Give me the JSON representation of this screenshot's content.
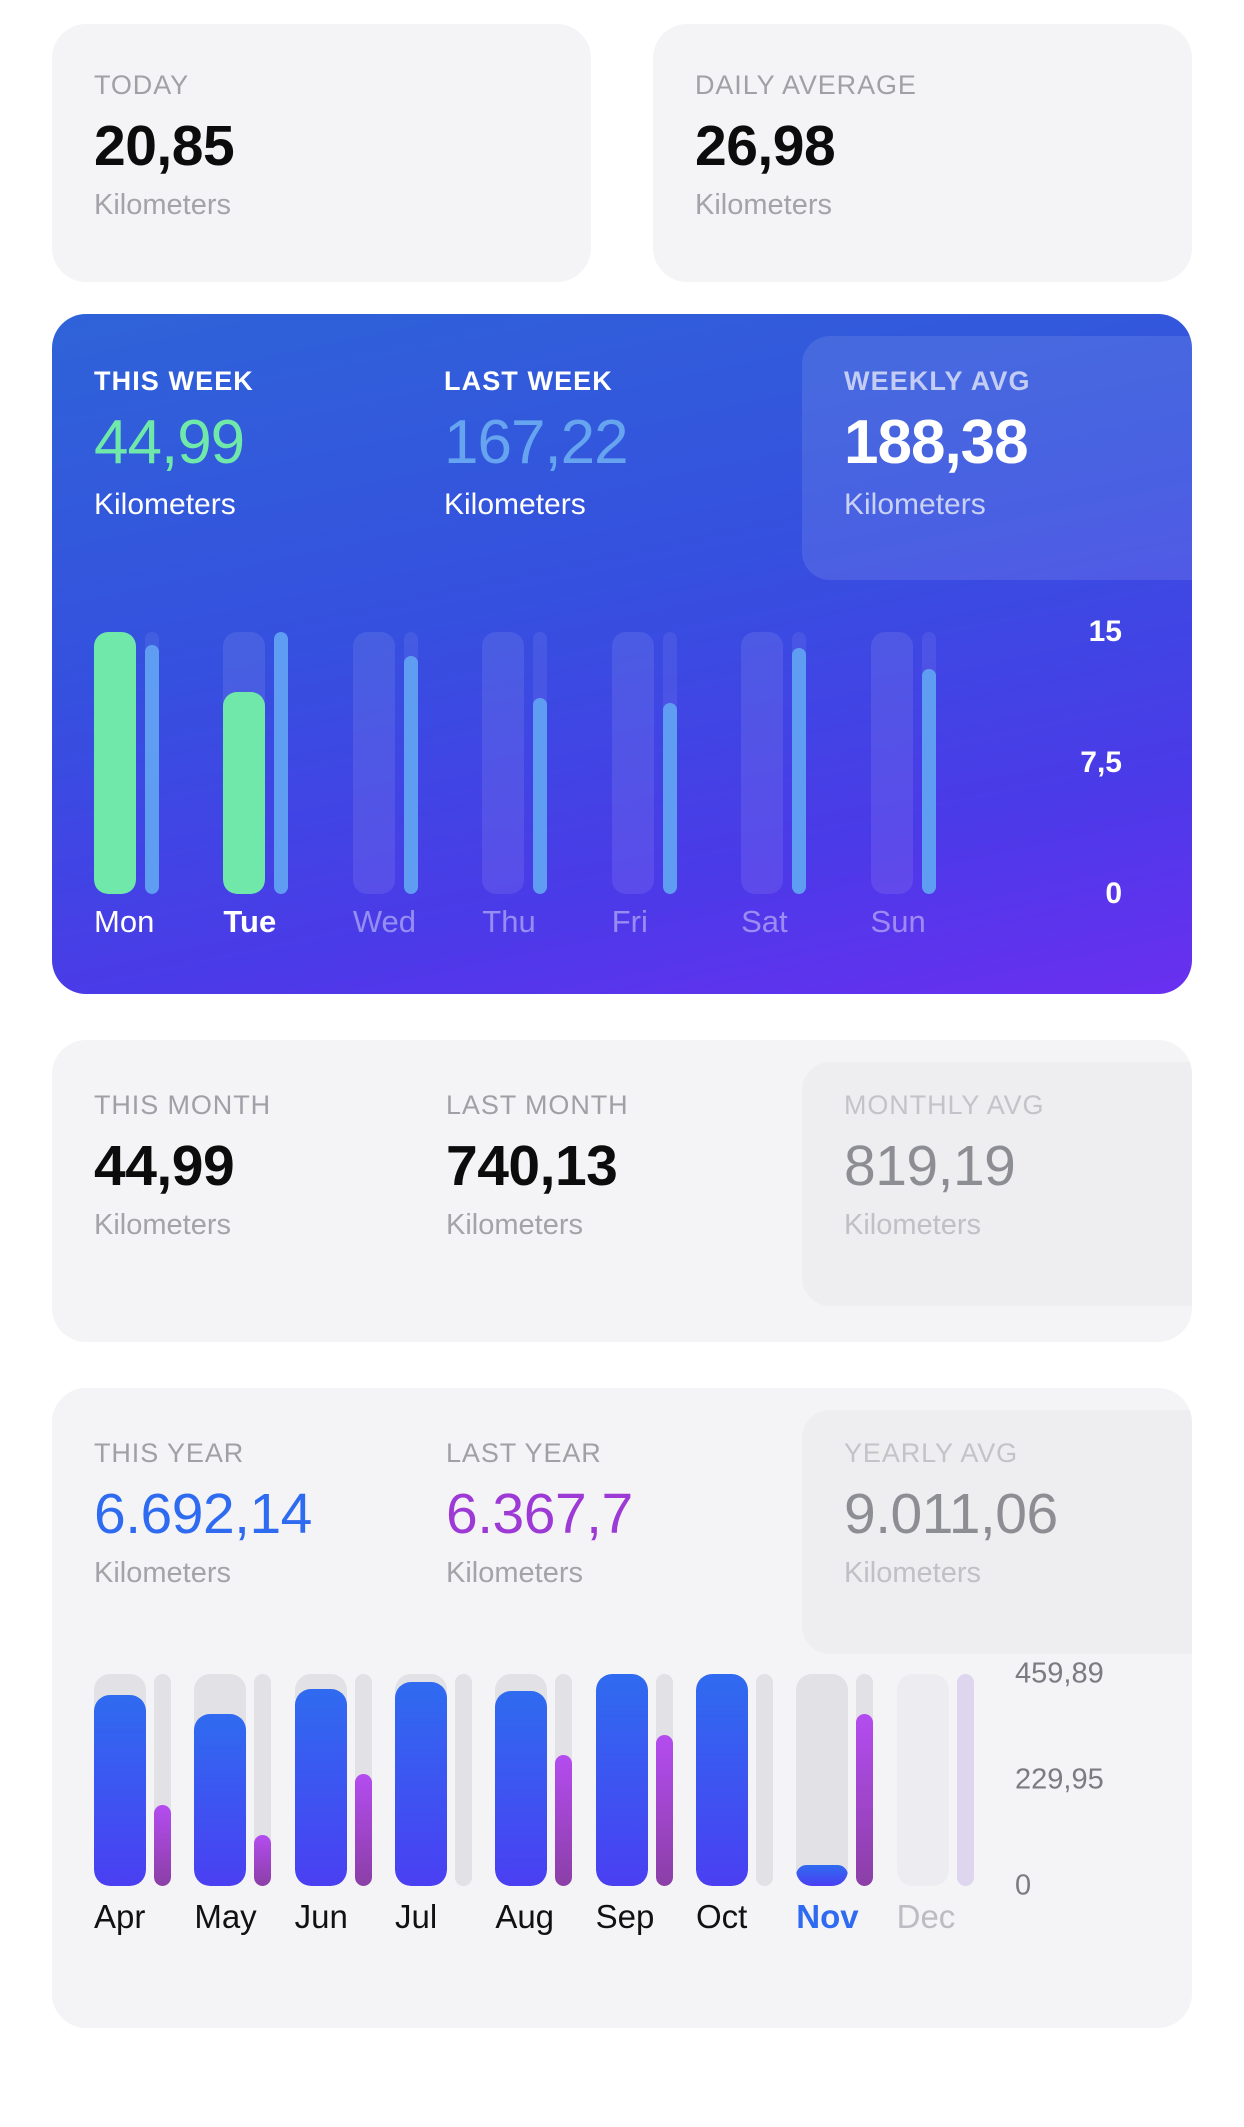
{
  "unit": "Kilometers",
  "colors": {
    "green": "#6fe8a9",
    "light_blue": "#67a4ef",
    "blue": "#2f6bf0",
    "purple": "#9d3ad6",
    "card_bg": "#f4f4f6"
  },
  "today": {
    "label": "TODAY",
    "value": "20,85",
    "unit": "Kilometers"
  },
  "daily_average": {
    "label": "DAILY AVERAGE",
    "value": "26,98",
    "unit": "Kilometers"
  },
  "week": {
    "this_week": {
      "label": "THIS WEEK",
      "value": "44,99",
      "unit": "Kilometers"
    },
    "last_week": {
      "label": "LAST WEEK",
      "value": "167,22",
      "unit": "Kilometers"
    },
    "weekly_avg": {
      "label": "WEEKLY AVG",
      "value": "188,38",
      "unit": "Kilometers"
    }
  },
  "month": {
    "this_month": {
      "label": "THIS MONTH",
      "value": "44,99",
      "unit": "Kilometers"
    },
    "last_month": {
      "label": "LAST MONTH",
      "value": "740,13",
      "unit": "Kilometers"
    },
    "monthly_avg": {
      "label": "MONTHLY AVG",
      "value": "819,19",
      "unit": "Kilometers"
    }
  },
  "year": {
    "this_year": {
      "label": "THIS YEAR",
      "value": "6.692,14",
      "unit": "Kilometers"
    },
    "last_year": {
      "label": "LAST YEAR",
      "value": "6.367,7",
      "unit": "Kilometers"
    },
    "yearly_avg": {
      "label": "YEARLY AVG",
      "value": "9.011,06",
      "unit": "Kilometers"
    }
  },
  "chart_data": [
    {
      "type": "bar",
      "title": "This week vs last week daily distance",
      "xlabel": "",
      "ylabel": "Kilometers",
      "categories": [
        "Mon",
        "Tue",
        "Wed",
        "Thu",
        "Fri",
        "Sat",
        "Sun"
      ],
      "ylim": [
        0,
        15
      ],
      "yticks": [
        "0",
        "7,5",
        "15"
      ],
      "grid": false,
      "legend": "none",
      "current_category": "Tue",
      "series": [
        {
          "name": "This week",
          "color": "#6fe8a9",
          "values": [
            15,
            11.5,
            0,
            0,
            0,
            0,
            0
          ]
        },
        {
          "name": "Last week",
          "color": "#5f9df3",
          "values": [
            14.2,
            15,
            13.6,
            11.2,
            10.9,
            14.1,
            12.8
          ]
        }
      ]
    },
    {
      "type": "bar",
      "title": "This year vs last year monthly distance",
      "xlabel": "",
      "ylabel": "Kilometers",
      "categories": [
        "Apr",
        "May",
        "Jun",
        "Jul",
        "Aug",
        "Sep",
        "Oct",
        "Nov",
        "Dec"
      ],
      "ylim": [
        0,
        459.89
      ],
      "yticks": [
        "0",
        "229,95",
        "459,89"
      ],
      "grid": false,
      "legend": "none",
      "current_category": "Nov",
      "series": [
        {
          "name": "This year",
          "color": "#2f6bf0",
          "values": [
            415,
            375,
            429,
            442,
            423,
            460,
            459,
            45,
            0
          ]
        },
        {
          "name": "Last year",
          "color": "#b44cf0",
          "values": [
            175,
            110,
            245,
            0,
            285,
            325,
            0,
            372,
            0
          ]
        }
      ]
    }
  ],
  "week_chart_render": {
    "bars": [
      {
        "day": "Mon",
        "state": "active",
        "primary_pct": 100,
        "secondary_pct": 95
      },
      {
        "day": "Tue",
        "state": "current",
        "primary_pct": 77,
        "secondary_pct": 100
      },
      {
        "day": "Wed",
        "state": "future",
        "primary_pct": 0,
        "secondary_pct": 91
      },
      {
        "day": "Thu",
        "state": "future",
        "primary_pct": 0,
        "secondary_pct": 75
      },
      {
        "day": "Fri",
        "state": "future",
        "primary_pct": 0,
        "secondary_pct": 73
      },
      {
        "day": "Sat",
        "state": "future",
        "primary_pct": 0,
        "secondary_pct": 94
      },
      {
        "day": "Sun",
        "state": "future",
        "primary_pct": 0,
        "secondary_pct": 86
      }
    ],
    "ticks": [
      {
        "label": "15",
        "pos_pct": 0
      },
      {
        "label": "7,5",
        "pos_pct": 50
      },
      {
        "label": "0",
        "pos_pct": 100
      }
    ]
  },
  "year_chart_render": {
    "bars": [
      {
        "month": "Apr",
        "state": "past",
        "primary_pct": 90,
        "secondary_pct": 38
      },
      {
        "month": "May",
        "state": "past",
        "primary_pct": 81,
        "secondary_pct": 24
      },
      {
        "month": "Jun",
        "state": "past",
        "primary_pct": 93,
        "secondary_pct": 53
      },
      {
        "month": "Jul",
        "state": "past",
        "primary_pct": 96,
        "secondary_pct": 0
      },
      {
        "month": "Aug",
        "state": "past",
        "primary_pct": 92,
        "secondary_pct": 62
      },
      {
        "month": "Sep",
        "state": "past",
        "primary_pct": 100,
        "secondary_pct": 71
      },
      {
        "month": "Oct",
        "state": "past",
        "primary_pct": 100,
        "secondary_pct": 0
      },
      {
        "month": "Nov",
        "state": "current",
        "primary_pct": 10,
        "secondary_pct": 81
      },
      {
        "month": "Dec",
        "state": "future",
        "primary_pct": 0,
        "secondary_pct": 0
      }
    ],
    "ticks": [
      {
        "label": "459,89",
        "pos_pct": 0
      },
      {
        "label": "229,95",
        "pos_pct": 50
      },
      {
        "label": "0",
        "pos_pct": 100
      }
    ]
  }
}
